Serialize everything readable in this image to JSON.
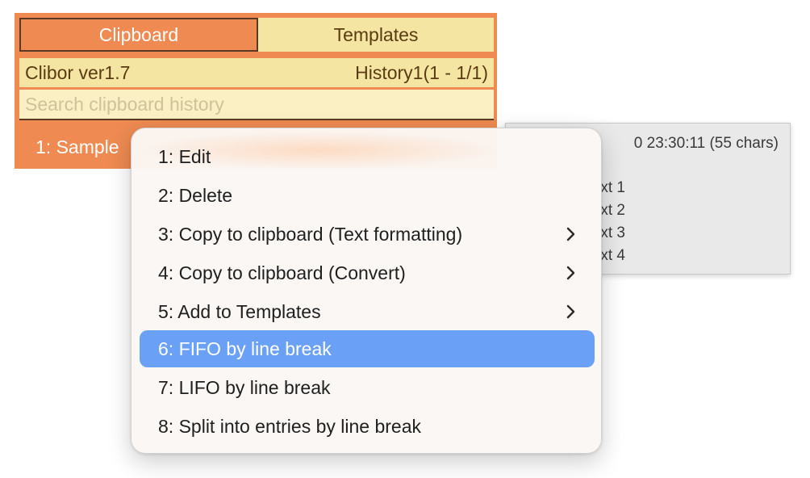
{
  "app": {
    "tabs": [
      {
        "label": "Clipboard",
        "active": true
      },
      {
        "label": "Templates",
        "active": false
      }
    ],
    "version_label": "Clibor ver1.7",
    "history_label": "History1(1 - 1/1)",
    "search_placeholder": "Search clipboard history",
    "entries": [
      {
        "label": "1: Sample"
      }
    ]
  },
  "preview": {
    "header": "0 23:30:11 (55 chars)",
    "lines": [
      "xt 1",
      "xt 2",
      "xt 3",
      "xt 4"
    ]
  },
  "context_menu": {
    "items": [
      {
        "label": "1: Edit",
        "submenu": false
      },
      {
        "label": "2: Delete",
        "submenu": false
      },
      {
        "label": "3: Copy to clipboard (Text formatting)",
        "submenu": true
      },
      {
        "label": "4: Copy to clipboard (Convert)",
        "submenu": true
      },
      {
        "label": "5: Add to Templates",
        "submenu": true
      },
      {
        "label": "6: FIFO by line break",
        "submenu": false,
        "highlighted": true
      },
      {
        "label": "7: LIFO by line break",
        "submenu": false
      },
      {
        "label": "8: Split into entries by line break",
        "submenu": false
      }
    ]
  },
  "colors": {
    "window_orange": "#ee8a52",
    "pale_yellow": "#f5e5a3",
    "highlight_blue": "#6aa1f6"
  }
}
